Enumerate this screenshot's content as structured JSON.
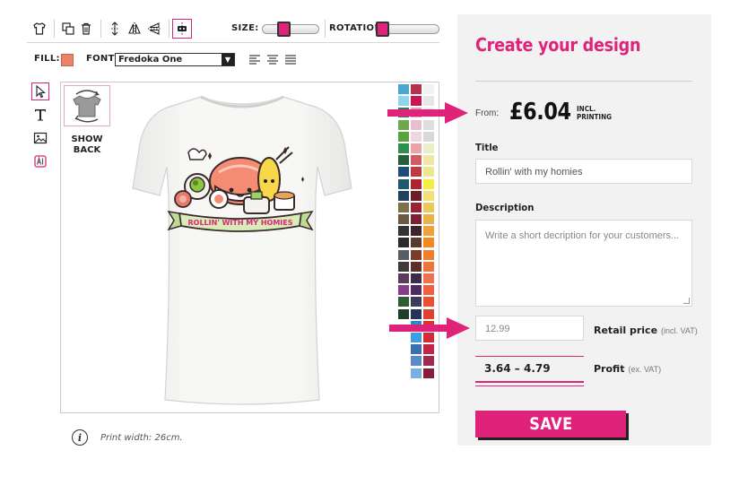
{
  "toolbar": {
    "size_label": "SIZE:",
    "size_value": 0.35,
    "rotation_label": "ROTATION:",
    "rotation_value": 0.0,
    "fill_label": "FILL:",
    "fill_color": "#ea8468",
    "font_label": "FONT:",
    "font_value": "Fredoka One"
  },
  "canvas": {
    "show_back_line1": "SHOW",
    "show_back_line2": "BACK",
    "design_banner_text": "ROLLIN' WITH MY HOMIES",
    "print_info": "Print width: 26cm.",
    "info_icon": "i",
    "palette_colors": [
      "#4aa7cf",
      "#b5334d",
      "#f2f2f2",
      "#8fd6e8",
      "#c8154f",
      "#e6e6e6",
      "#2e7d5a",
      "#d4a4b8",
      "#eeeeee",
      "#6fa84c",
      "#e6bfd0",
      "#dedede",
      "#5aa33a",
      "#ebd7e0",
      "#d8d8d8",
      "#2f8f4e",
      "#e9a4a9",
      "#e9f0c9",
      "#255f38",
      "#d25b63",
      "#f2e6a6",
      "#1d4e7a",
      "#c03a41",
      "#ebe88f",
      "#1e5a6c",
      "#b02131",
      "#f2ef3f",
      "#21425e",
      "#6b1e25",
      "#f3e07a",
      "#7e7048",
      "#9a2233",
      "#eac95b",
      "#6b5a43",
      "#7b1f33",
      "#e6b44a",
      "#333333",
      "#3b2328",
      "#f0a13a",
      "#2b2b2b",
      "#5a3a2a",
      "#f28a1f",
      "#585e66",
      "#7a3b2b",
      "#f27e2b",
      "#3e3a36",
      "#5e2e2a",
      "#f0733a",
      "#5a3b5a",
      "#3f2a4a",
      "#f07050",
      "#8a3a8a",
      "#4e2a5e",
      "#f06040",
      "#2e5d33",
      "#3b3b5a",
      "#e85033",
      "#1c3e2a",
      "#26325a",
      "#e04030",
      "#ffffff",
      "#2a8acb",
      "#e0302a",
      "#ffffff",
      "#3a9ee0",
      "#d42a36",
      "#ffffff",
      "#3b6fb4",
      "#c42446",
      "#ffffff",
      "#5b8acb",
      "#a02a4e",
      "#ffffff",
      "#7ab0e0",
      "#8a1e3a"
    ]
  },
  "panel": {
    "title": "Create your design",
    "from_label": "From:",
    "price": "£6.04",
    "price_note_line1": "INCL.",
    "price_note_line2": "PRINTING",
    "title_label": "Title",
    "title_value": "Rollin' with my homies",
    "description_label": "Description",
    "description_placeholder": "Write a short decription for your customers...",
    "retail_value": "12.99",
    "retail_label": "Retail price",
    "retail_note": "(incl. VAT)",
    "profit_value": "3.64 – 4.79",
    "profit_label": "Profit",
    "profit_note": "(ex. VAT)",
    "save_label": "SAVE"
  },
  "colors": {
    "accent": "#e0237a",
    "panel_bg": "#f2f2f2"
  }
}
